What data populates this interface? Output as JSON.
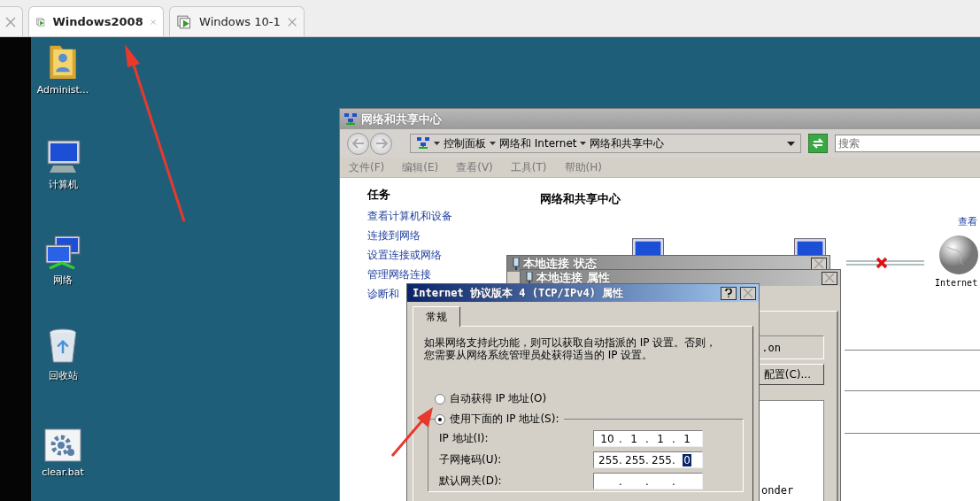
{
  "browser_tabs": [
    {
      "kind": "partial"
    },
    {
      "kind": "vm",
      "label": "Windows2008",
      "selected": true
    },
    {
      "kind": "vm",
      "label": "Windows 10-1",
      "selected": false
    }
  ],
  "desktop_icons": [
    {
      "kind": "folder",
      "label": "Administ..."
    },
    {
      "kind": "computer",
      "label": "计算机"
    },
    {
      "kind": "network",
      "label": "网络"
    },
    {
      "kind": "recycle",
      "label": "回收站"
    },
    {
      "kind": "batch",
      "label": "clear.bat"
    }
  ],
  "network_window": {
    "title": "网络和共享中心",
    "breadcrumb": [
      "控制面板",
      "网络和 Internet",
      "网络和共享中心"
    ],
    "search": {
      "placeholder": "搜索"
    },
    "menu": [
      "文件(F)",
      "编辑(E)",
      "查看(V)",
      "工具(T)",
      "帮助(H)"
    ],
    "tasks_heading": "任务",
    "tasks": [
      "查看计算机和设备",
      "连接到网络",
      "设置连接或网络",
      "管理网络连接",
      "诊断和"
    ],
    "heading": "网络和共享中心",
    "view_link": "查看",
    "internet_label": "Internet"
  },
  "status_dialog": {
    "title": "本地连接 状态"
  },
  "properties_dialog": {
    "title": "本地连接 属性",
    "field_value": ".on",
    "configure_button": "配置(C)...",
    "list_item": "onder"
  },
  "ipv4_dialog": {
    "title": "Internet 协议版本 4 (TCP/IPv4) 属性",
    "tabs": [
      {
        "label": "常规",
        "selected": true
      }
    ],
    "description": "如果网络支持此功能，则可以获取自动指派的 IP 设置。否则，您需要从网络系统管理员处获得适当的 IP 设置。",
    "radios": [
      {
        "label": "自动获得 IP 地址(O)",
        "selected": false
      },
      {
        "label": "使用下面的 IP 地址(S):",
        "selected": true
      }
    ],
    "fields": [
      {
        "label": "IP 地址(I):",
        "separator": ".",
        "octets": [
          {
            "text": "10",
            "selected": false
          },
          {
            "text": "1",
            "selected": false
          },
          {
            "text": "1",
            "selected": false
          },
          {
            "text": "1",
            "selected": false
          }
        ]
      },
      {
        "label": "子网掩码(U):",
        "separator": ".",
        "octets": [
          {
            "text": "255",
            "selected": false
          },
          {
            "text": "255",
            "selected": false
          },
          {
            "text": "255",
            "selected": false
          },
          {
            "text": "0",
            "selected": true
          }
        ]
      },
      {
        "label": "默认网关(D):",
        "separator": "."
      }
    ]
  }
}
